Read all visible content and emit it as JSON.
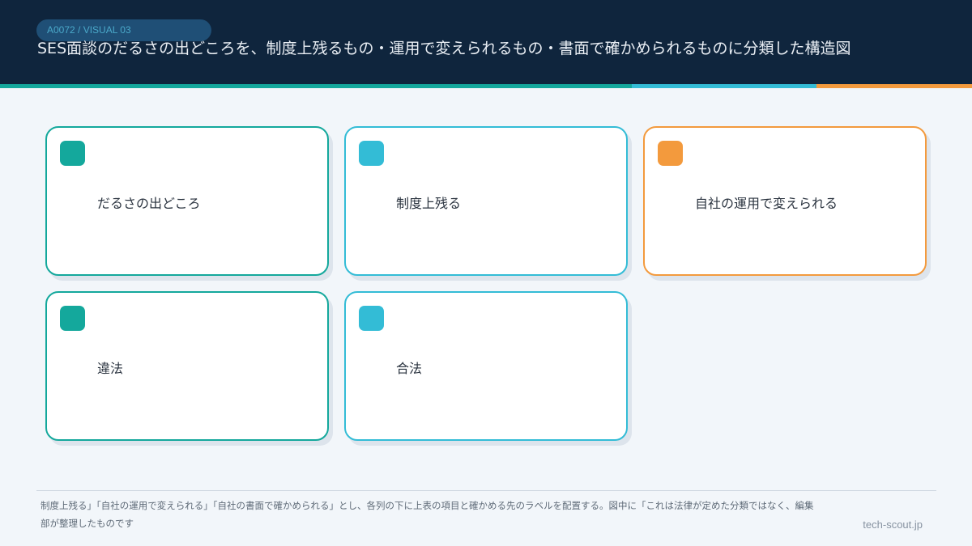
{
  "header": {
    "badge": "A0072 / VISUAL 03",
    "title": "SES面談のだるさの出どころを、制度上残るもの・運用で変えられるもの・書面で確かめられるものに分類した構造図"
  },
  "colors": {
    "header_bg": "#0f253d",
    "teal": "#14a89c",
    "cyan": "#33bcd6",
    "orange": "#f39a3d",
    "background": "#f2f6fa"
  },
  "accent_bar": [
    {
      "color": "#14a89c",
      "fraction": 0.65
    },
    {
      "color": "#33bcd6",
      "fraction": 0.19
    },
    {
      "color": "#f39a3d",
      "fraction": 0.16
    }
  ],
  "cards": [
    {
      "label": "だるさの出どころ",
      "color": "#14a89c"
    },
    {
      "label": "制度上残る",
      "color": "#33bcd6"
    },
    {
      "label": "自社の運用で変えられる",
      "color": "#f39a3d"
    },
    {
      "label": "違法",
      "color": "#14a89c"
    },
    {
      "label": "合法",
      "color": "#33bcd6"
    }
  ],
  "footer": {
    "note": "制度上残る」「自社の運用で変えられる」「自社の書面で確かめられる」とし、各列の下に上表の項目と確かめる先のラベルを配置する。図中に「これは法律が定めた分類ではなく、編集部が整理したものです",
    "site": "tech-scout.jp"
  }
}
